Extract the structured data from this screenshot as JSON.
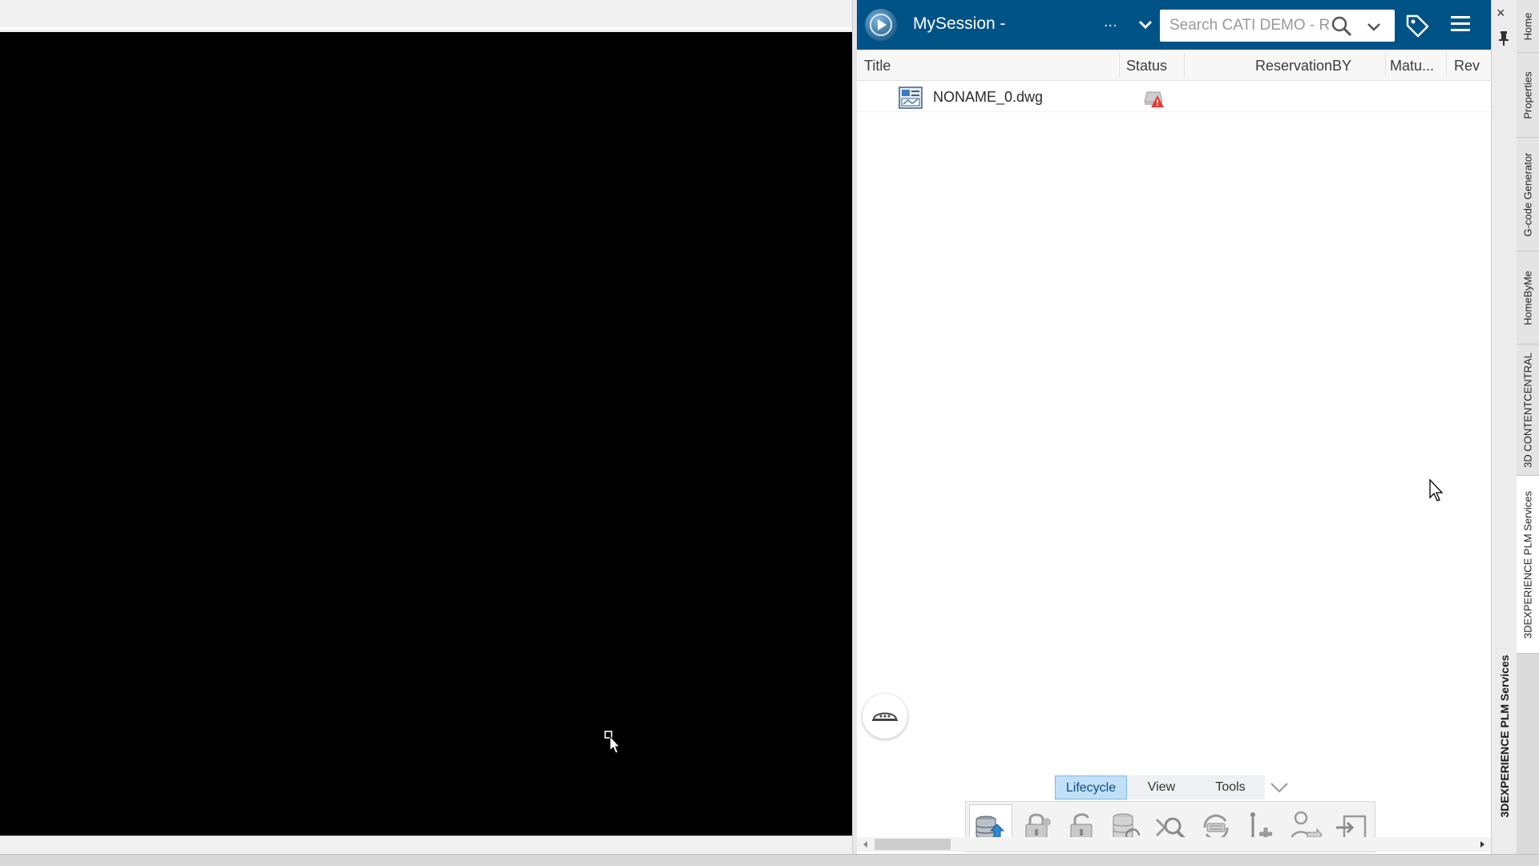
{
  "header": {
    "session_title": "MySession -",
    "ellipsis": "...",
    "search_placeholder": "Search CATI DEMO - R"
  },
  "table": {
    "columns": [
      "Title",
      "Status",
      "ReservationBY",
      "Matu...",
      "Rev"
    ],
    "rows": [
      {
        "title": "NONAME_0.dwg",
        "status_icon": "warning-status-icon"
      }
    ]
  },
  "tabs": {
    "lifecycle": "Lifecycle",
    "view": "View",
    "tools": "Tools",
    "active": "Lifecycle"
  },
  "toolbar": {
    "icons": [
      "save-icon",
      "reserve-icon",
      "unreserve-icon",
      "update-icon",
      "explore-icon",
      "sync-icon",
      "revise-icon",
      "transfer-ownership-icon",
      "insert-icon"
    ]
  },
  "rail": {
    "label": "3DEXPERIENCE PLM Services",
    "close": "×"
  },
  "sidetabs": [
    "Home",
    "Properties",
    "G-code Generator",
    "HomeByMe",
    "3D CONTENTCENTRAL",
    "3DEXPERIENCE PLM Services"
  ],
  "colors": {
    "header_bg": "#005386",
    "active_tab": "#bfe0f7"
  }
}
